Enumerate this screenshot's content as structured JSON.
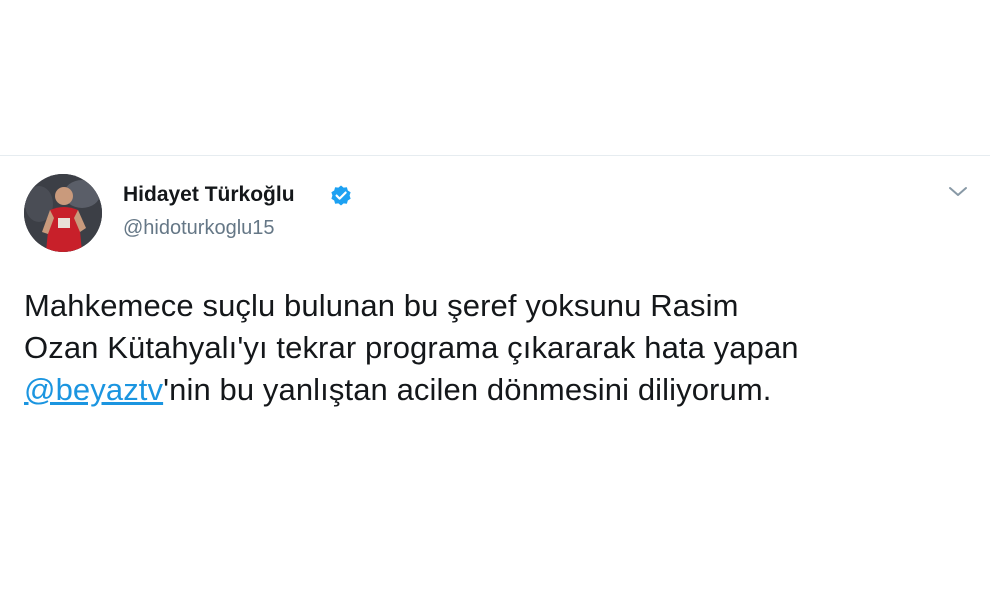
{
  "tweet": {
    "author": {
      "display_name": "Hidayet Türkoğlu",
      "handle": "@hidoturkoglu15",
      "verified": true
    },
    "text_lines": {
      "line1": "Mahkemece suçlu bulunan bu şeref yoksunu Rasim",
      "line2": "Ozan Kütahyalı'yı tekrar programa çıkararak hata yapan",
      "line3_mention": "@beyaztv",
      "line3_rest": "'nin bu yanlıştan acilen dönmesini diliyorum."
    }
  },
  "colors": {
    "mention": "#1b95e0",
    "verified_badge": "#1da1f2",
    "handle": "#657786",
    "divider": "#e6ecf0"
  },
  "icons": {
    "verified": "verified-badge-icon",
    "menu": "chevron-down-icon"
  }
}
